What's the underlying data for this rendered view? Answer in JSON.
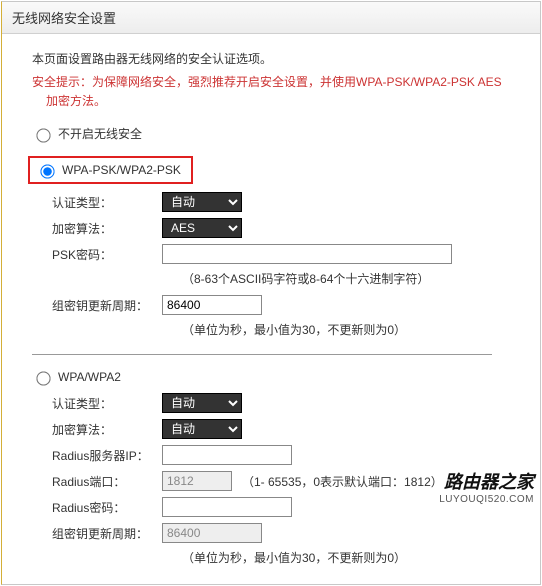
{
  "header": {
    "title": "无线网络安全设置"
  },
  "intro": {
    "line": "本页面设置路由器无线网络的安全认证选项。"
  },
  "warning": {
    "line1": "安全提示：为保障网络安全，强烈推荐开启安全设置，并使用WPA-PSK/WPA2-PSK AES",
    "line2": "加密方法。"
  },
  "options": {
    "disable": "不开启无线安全",
    "wpapsk": "WPA-PSK/WPA2-PSK",
    "wpa": "WPA/WPA2"
  },
  "labels": {
    "auth": "认证类型：",
    "enc": "加密算法：",
    "psk": "PSK密码：",
    "rekey": "组密钥更新周期：",
    "radius_ip": "Radius服务器IP：",
    "radius_port": "Radius端口：",
    "radius_pwd": "Radius密码："
  },
  "psk": {
    "auth_options": [
      "自动"
    ],
    "enc_options": [
      "AES"
    ],
    "password": "",
    "password_hint": "（8-63个ASCII码字符或8-64个十六进制字符）",
    "rekey": "86400",
    "rekey_hint": "（单位为秒，最小值为30，不更新则为0）"
  },
  "wpa": {
    "auth_options": [
      "自动"
    ],
    "enc_options": [
      "自动"
    ],
    "radius_ip": "",
    "radius_port": "1812",
    "radius_port_hint": "（1- 65535，0表示默认端口：1812）",
    "radius_pwd": "",
    "rekey": "86400",
    "rekey_hint": "（单位为秒，最小值为30，不更新则为0）"
  },
  "watermark": {
    "big": "路由器之家",
    "small": "LUYOUQI520.COM"
  }
}
